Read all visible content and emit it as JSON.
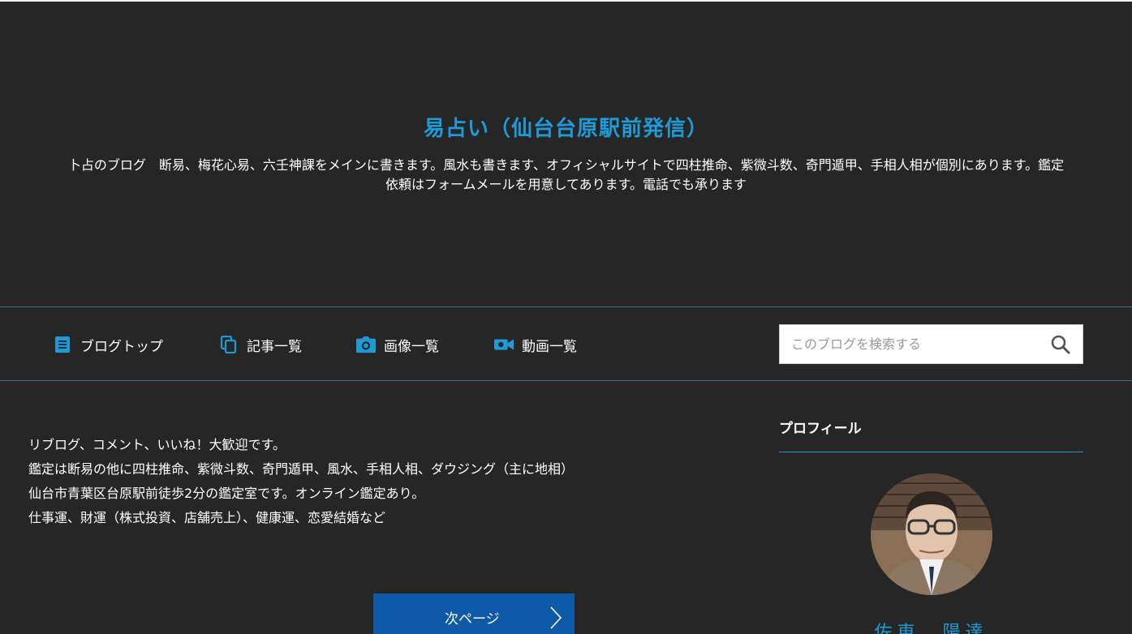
{
  "header": {
    "title": "易占い（仙台台原駅前発信）",
    "description": "卜占のブログ　断易、梅花心易、六壬神課をメインに書きます。風水も書きます、オフィシャルサイトで四柱推命、紫微斗数、奇門遁甲、手相人相が個別にあります。鑑定依頼はフォームメールを用意してあります。電話でも承ります"
  },
  "nav": {
    "items": [
      {
        "label": "ブログトップ",
        "icon": "document-icon"
      },
      {
        "label": "記事一覧",
        "icon": "copy-icon"
      },
      {
        "label": "画像一覧",
        "icon": "camera-icon"
      },
      {
        "label": "動画一覧",
        "icon": "video-camera-icon"
      }
    ],
    "search": {
      "placeholder": "このブログを検索する",
      "value": "",
      "icon": "search-icon"
    }
  },
  "main": {
    "intro_lines": [
      "リブログ、コメント、いいね！大歓迎です。",
      "鑑定は断易の他に四柱推命、紫微斗数、奇門遁甲、風水、手相人相、ダウジング（主に地相）",
      "仙台市青葉区台原駅前徒歩2分の鑑定室です。オンライン鑑定あり。",
      "仕事運、財運（株式投資、店舗売上）、健康運、恋愛結婚など"
    ],
    "next_page_label": "次ページ"
  },
  "sidebar": {
    "profile_title": "プロフィール",
    "profile_name": "佐東　陽達"
  },
  "colors": {
    "background": "#262626",
    "accent": "#1e9bd7",
    "button": "#0f5aa8"
  }
}
